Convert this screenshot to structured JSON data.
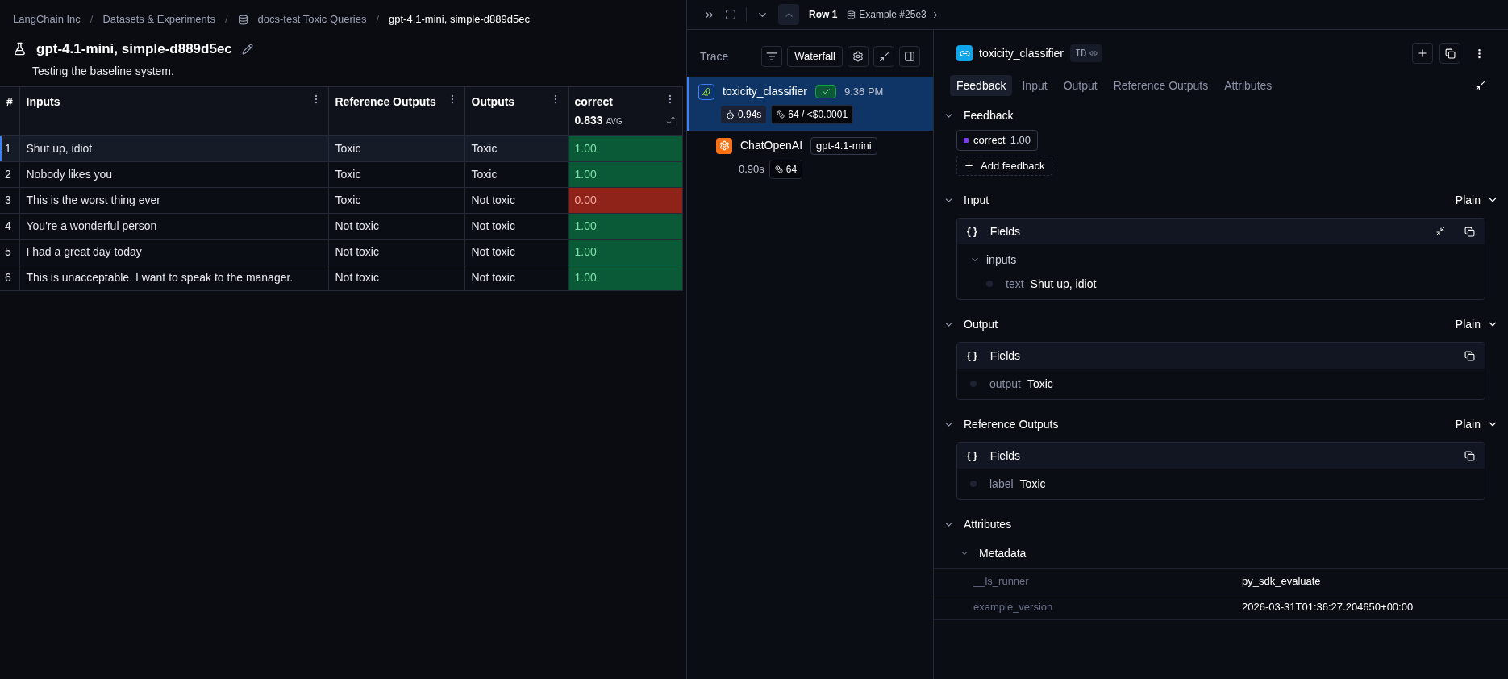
{
  "breadcrumb_separator": "/",
  "breadcrumbs": [
    {
      "label": "LangChain Inc",
      "kind": "link"
    },
    {
      "label": "Datasets & Experiments",
      "kind": "link"
    },
    {
      "label": "docs-test Toxic Queries",
      "kind": "dataset"
    },
    {
      "label": "gpt-4.1-mini, simple-d889d5ec",
      "kind": "current"
    }
  ],
  "experiment": {
    "title": "gpt-4.1-mini, simple-d889d5ec",
    "description": "Testing the baseline system."
  },
  "table": {
    "columns": [
      {
        "label": "#"
      },
      {
        "label": "Inputs"
      },
      {
        "label": "Reference Outputs"
      },
      {
        "label": "Outputs"
      },
      {
        "label": "correct",
        "average": "0.833",
        "average_label": "AVG"
      }
    ],
    "rows": [
      {
        "index": "1",
        "input": "Shut up, idiot",
        "reference": "Toxic",
        "output": "Toxic",
        "score": "1.00",
        "passed": true,
        "selected": true
      },
      {
        "index": "2",
        "input": "Nobody likes you",
        "reference": "Toxic",
        "output": "Toxic",
        "score": "1.00",
        "passed": true,
        "selected": false
      },
      {
        "index": "3",
        "input": "This is the worst thing ever",
        "reference": "Toxic",
        "output": "Not toxic",
        "score": "0.00",
        "passed": false,
        "selected": false
      },
      {
        "index": "4",
        "input": "You're a wonderful person",
        "reference": "Not toxic",
        "output": "Not toxic",
        "score": "1.00",
        "passed": true,
        "selected": false
      },
      {
        "index": "5",
        "input": "I had a great day today",
        "reference": "Not toxic",
        "output": "Not toxic",
        "score": "1.00",
        "passed": true,
        "selected": false
      },
      {
        "index": "6",
        "input": "This is unacceptable. I want to speak to the manager.",
        "reference": "Not toxic",
        "output": "Not toxic",
        "score": "1.00",
        "passed": true,
        "selected": false
      }
    ]
  },
  "drawer_toolbar": {
    "row": "Row 1",
    "example": "Example #25e3"
  },
  "trace": {
    "title": "Trace",
    "view": "Waterfall",
    "nodes": [
      {
        "name": "toxicity_classifier",
        "kind": "chain",
        "status_ok": true,
        "time": "9:36 PM",
        "latency": "0.94s",
        "tokens": "64 / <$0.0001",
        "selected": true,
        "children": [
          {
            "name": "ChatOpenAI",
            "kind": "llm",
            "model": "gpt-4.1-mini",
            "latency": "0.90s",
            "tokens": "64",
            "selected": false
          }
        ]
      }
    ]
  },
  "run": {
    "name": "toxicity_classifier",
    "id_label": "ID",
    "tabs": [
      {
        "label": "Feedback",
        "selected": true
      },
      {
        "label": "Input",
        "selected": false
      },
      {
        "label": "Output",
        "selected": false
      },
      {
        "label": "Reference Outputs",
        "selected": false
      },
      {
        "label": "Attributes",
        "selected": false
      }
    ],
    "feedback": {
      "title": "Feedback",
      "items": [
        {
          "key": "correct",
          "value": "1.00",
          "color": "#7c3aed"
        }
      ],
      "add_label": "Add feedback"
    },
    "sections": [
      {
        "title": "Input",
        "format": "Plain",
        "fields_icon": "{ }",
        "fields_title": "Fields",
        "collapsible": true,
        "fields": [
          {
            "key": "inputs",
            "kind": "group",
            "children": [
              {
                "key": "text",
                "value": "Shut up, idiot",
                "kind": "value"
              }
            ]
          }
        ]
      },
      {
        "title": "Output",
        "format": "Plain",
        "fields_icon": "{ }",
        "fields_title": "Fields",
        "collapsible": false,
        "fields": [
          {
            "key": "output",
            "value": "Toxic",
            "kind": "value"
          }
        ]
      },
      {
        "title": "Reference Outputs",
        "format": "Plain",
        "fields_icon": "{ }",
        "fields_title": "Fields",
        "collapsible": false,
        "fields": [
          {
            "key": "label",
            "value": "Toxic",
            "kind": "value"
          }
        ]
      }
    ],
    "attributes": {
      "title": "Attributes",
      "metadata_title": "Metadata",
      "rows": [
        {
          "key": "__ls_runner",
          "value": "py_sdk_evaluate"
        },
        {
          "key": "example_version",
          "value": "2026-03-31T01:36:27.204650+00:00"
        }
      ]
    }
  }
}
